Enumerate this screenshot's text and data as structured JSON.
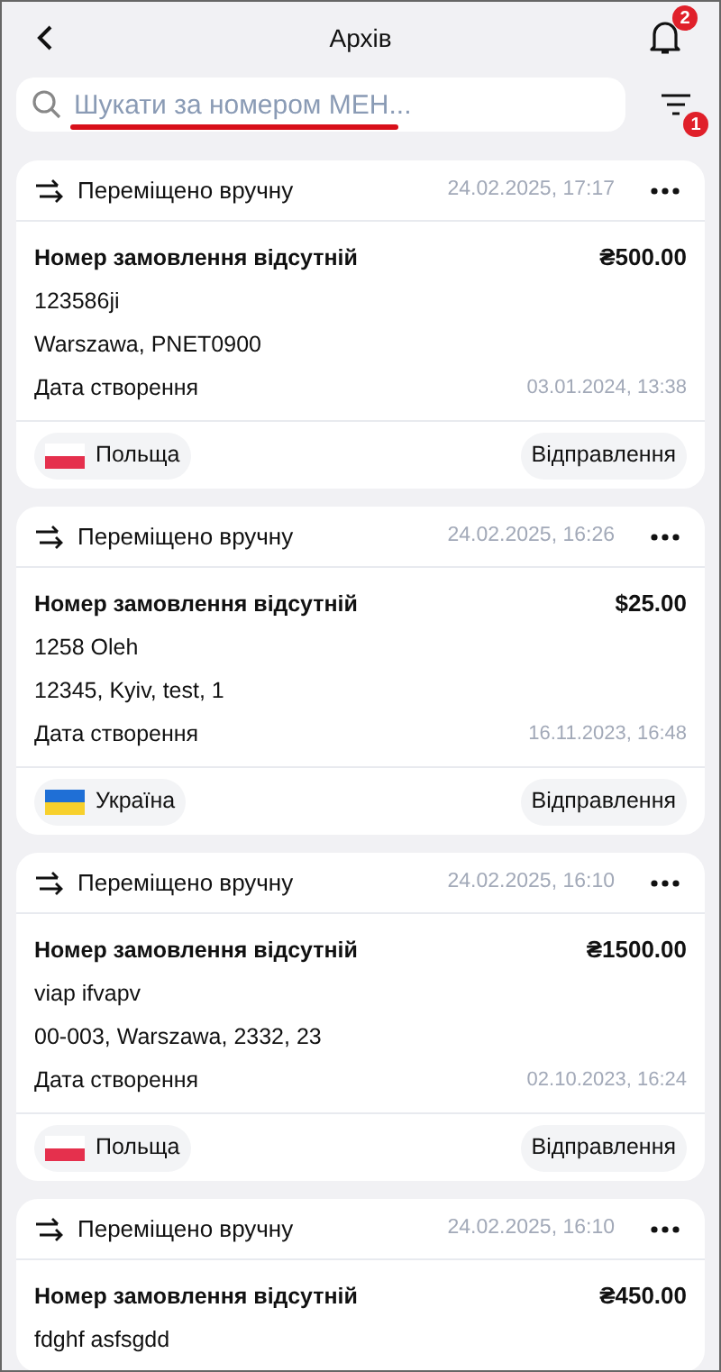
{
  "header": {
    "title": "Архів",
    "notification_count": "2"
  },
  "search": {
    "placeholder": "Шукати за номером МЕН...",
    "underlined": true
  },
  "filter": {
    "badge": "1"
  },
  "cards": [
    {
      "status": "Переміщено вручну",
      "time": "24.02.2025, 17:17",
      "title": "Номер замовлення відсутній",
      "amount": "₴500.00",
      "lines": [
        "123586ji",
        "Warszawa, PNET0900"
      ],
      "date_label": "Дата створення",
      "date": "03.01.2024, 13:38",
      "country": {
        "kind": "pl",
        "name": "Польща"
      },
      "action": "Відправлення"
    },
    {
      "status": "Переміщено вручну",
      "time": "24.02.2025, 16:26",
      "title": "Номер замовлення відсутній",
      "amount": "$25.00",
      "lines": [
        "1258 Oleh",
        "12345, Kyiv, test, 1"
      ],
      "date_label": "Дата створення",
      "date": "16.11.2023, 16:48",
      "country": {
        "kind": "ua",
        "name": "Україна"
      },
      "action": "Відправлення"
    },
    {
      "status": "Переміщено вручну",
      "time": "24.02.2025, 16:10",
      "title": "Номер замовлення відсутній",
      "amount": "₴1500.00",
      "lines": [
        "viap ifvapv",
        "00-003, Warszawa, 2332, 23"
      ],
      "date_label": "Дата створення",
      "date": "02.10.2023, 16:24",
      "country": {
        "kind": "pl",
        "name": "Польща"
      },
      "action": "Відправлення"
    },
    {
      "status": "Переміщено вручну",
      "time": "24.02.2025, 16:10",
      "title": "Номер замовлення відсутній",
      "amount": "₴450.00",
      "lines": [
        "fdghf asfsgdd"
      ]
    }
  ]
}
